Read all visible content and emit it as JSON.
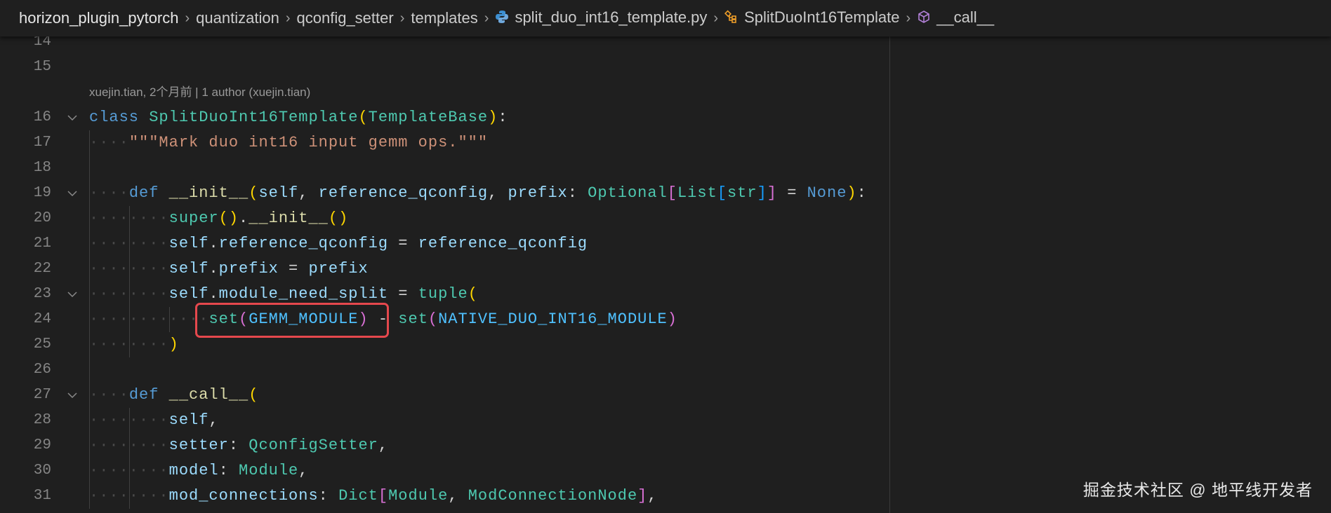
{
  "breadcrumb": {
    "items": [
      {
        "label": "horizon_plugin_pytorch",
        "icon": null
      },
      {
        "label": "quantization",
        "icon": null
      },
      {
        "label": "qconfig_setter",
        "icon": null
      },
      {
        "label": "templates",
        "icon": null
      },
      {
        "label": "split_duo_int16_template.py",
        "icon": "python-file-icon"
      },
      {
        "label": "SplitDuoInt16Template",
        "icon": "class-symbol-icon"
      },
      {
        "label": "__call__",
        "icon": "method-symbol-icon"
      }
    ]
  },
  "theme": {
    "kw": "#569cd6",
    "cls": "#4ec9b0",
    "fn": "#dcdcaa",
    "var": "#9cdcfe",
    "str": "#ce9178",
    "const": "#4fc1ff",
    "punct": "#d4d4d4",
    "b1": "#ffd700",
    "b2": "#da70d6",
    "b3": "#179fff",
    "ws": "#4a4a4a"
  },
  "codelens": "xuejin.tian, 2个月前 | 1 author (xuejin.tian)",
  "lines": [
    {
      "n": "14",
      "fold": false,
      "tokens": []
    },
    {
      "n": "15",
      "fold": false,
      "tokens": []
    },
    {
      "lens": true
    },
    {
      "n": "16",
      "fold": true,
      "tokens": [
        [
          "class ",
          "kw"
        ],
        [
          "SplitDuoInt16Template",
          "cls"
        ],
        [
          "(",
          "b1"
        ],
        [
          "TemplateBase",
          "cls"
        ],
        [
          ")",
          "b1"
        ],
        [
          ":",
          "punct"
        ]
      ]
    },
    {
      "n": "17",
      "fold": false,
      "tokens": [
        [
          "    ",
          "ws"
        ],
        [
          "\"\"\"Mark duo int16 input gemm ops.\"\"\"",
          "str"
        ]
      ]
    },
    {
      "n": "18",
      "fold": false,
      "tokens": []
    },
    {
      "n": "19",
      "fold": true,
      "tokens": [
        [
          "    ",
          "ws"
        ],
        [
          "def ",
          "kw"
        ],
        [
          "__init__",
          "fn"
        ],
        [
          "(",
          "b1"
        ],
        [
          "self",
          "var"
        ],
        [
          ", ",
          "punct"
        ],
        [
          "reference_qconfig",
          "var"
        ],
        [
          ", ",
          "punct"
        ],
        [
          "prefix",
          "var"
        ],
        [
          ": ",
          "punct"
        ],
        [
          "Optional",
          "cls"
        ],
        [
          "[",
          "b2"
        ],
        [
          "List",
          "cls"
        ],
        [
          "[",
          "b3"
        ],
        [
          "str",
          "cls"
        ],
        [
          "]",
          "b3"
        ],
        [
          "]",
          "b2"
        ],
        [
          " = ",
          "punct"
        ],
        [
          "None",
          "kw"
        ],
        [
          ")",
          "b1"
        ],
        [
          ":",
          "punct"
        ]
      ]
    },
    {
      "n": "20",
      "fold": false,
      "tokens": [
        [
          "        ",
          "ws"
        ],
        [
          "super",
          "cls"
        ],
        [
          "()",
          "b1"
        ],
        [
          ".",
          "punct"
        ],
        [
          "__init__",
          "fn"
        ],
        [
          "()",
          "b1"
        ]
      ]
    },
    {
      "n": "21",
      "fold": false,
      "tokens": [
        [
          "        ",
          "ws"
        ],
        [
          "self",
          "var"
        ],
        [
          ".",
          "punct"
        ],
        [
          "reference_qconfig",
          "var"
        ],
        [
          " = ",
          "punct"
        ],
        [
          "reference_qconfig",
          "var"
        ]
      ]
    },
    {
      "n": "22",
      "fold": false,
      "tokens": [
        [
          "        ",
          "ws"
        ],
        [
          "self",
          "var"
        ],
        [
          ".",
          "punct"
        ],
        [
          "prefix",
          "var"
        ],
        [
          " = ",
          "punct"
        ],
        [
          "prefix",
          "var"
        ]
      ]
    },
    {
      "n": "23",
      "fold": true,
      "tokens": [
        [
          "        ",
          "ws"
        ],
        [
          "self",
          "var"
        ],
        [
          ".",
          "punct"
        ],
        [
          "module_need_split",
          "var"
        ],
        [
          " = ",
          "punct"
        ],
        [
          "tuple",
          "cls"
        ],
        [
          "(",
          "b1"
        ]
      ]
    },
    {
      "n": "24",
      "fold": false,
      "tokens": [
        [
          "            ",
          "ws"
        ],
        [
          "set",
          "cls"
        ],
        [
          "(",
          "b2"
        ],
        [
          "GEMM_MODULE",
          "const"
        ],
        [
          ")",
          "b2"
        ],
        [
          " - ",
          "punct"
        ],
        [
          "set",
          "cls"
        ],
        [
          "(",
          "b2"
        ],
        [
          "NATIVE_DUO_INT16_MODULE",
          "const"
        ],
        [
          ")",
          "b2"
        ]
      ]
    },
    {
      "n": "25",
      "fold": false,
      "tokens": [
        [
          "        ",
          "ws"
        ],
        [
          ")",
          "b1"
        ]
      ]
    },
    {
      "n": "26",
      "fold": false,
      "tokens": []
    },
    {
      "n": "27",
      "fold": true,
      "tokens": [
        [
          "    ",
          "ws"
        ],
        [
          "def ",
          "kw"
        ],
        [
          "__call__",
          "fn"
        ],
        [
          "(",
          "b1"
        ]
      ]
    },
    {
      "n": "28",
      "fold": false,
      "tokens": [
        [
          "        ",
          "ws"
        ],
        [
          "self",
          "var"
        ],
        [
          ",",
          "punct"
        ]
      ]
    },
    {
      "n": "29",
      "fold": false,
      "tokens": [
        [
          "        ",
          "ws"
        ],
        [
          "setter",
          "var"
        ],
        [
          ": ",
          "punct"
        ],
        [
          "QconfigSetter",
          "cls"
        ],
        [
          ",",
          "punct"
        ]
      ]
    },
    {
      "n": "30",
      "fold": false,
      "tokens": [
        [
          "        ",
          "ws"
        ],
        [
          "model",
          "var"
        ],
        [
          ": ",
          "punct"
        ],
        [
          "Module",
          "cls"
        ],
        [
          ",",
          "punct"
        ]
      ]
    },
    {
      "n": "31",
      "fold": false,
      "tokens": [
        [
          "        ",
          "ws"
        ],
        [
          "mod_connections",
          "var"
        ],
        [
          ": ",
          "punct"
        ],
        [
          "Dict",
          "cls"
        ],
        [
          "[",
          "b2"
        ],
        [
          "Module",
          "cls"
        ],
        [
          ", ",
          "punct"
        ],
        [
          "ModConnectionNode",
          "cls"
        ],
        [
          "]",
          "b2"
        ],
        [
          ",",
          "punct"
        ]
      ]
    }
  ],
  "watermark": "掘金技术社区 @ 地平线开发者"
}
